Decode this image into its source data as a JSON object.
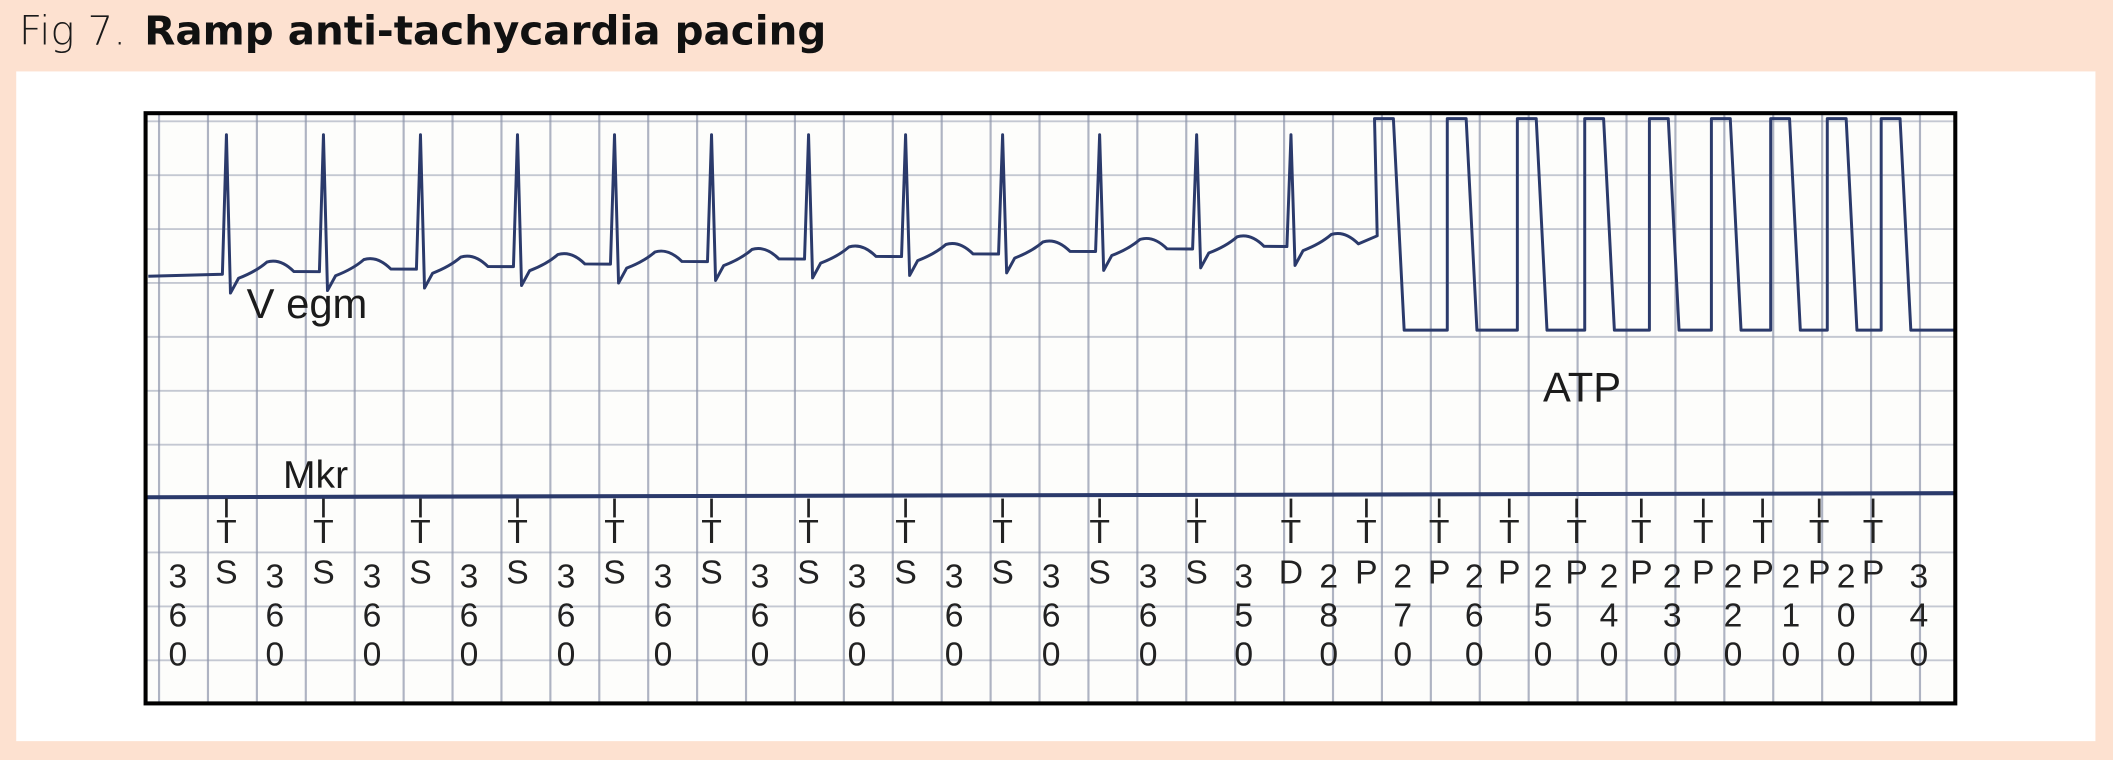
{
  "figure": {
    "label": "Fig 7.",
    "title": "Ramp anti-tachycardia pacing"
  },
  "strip": {
    "channel_top": "V egm",
    "pacing_label": "ATP",
    "channel_bottom": "Mkr"
  },
  "colors": {
    "background": "#fde1d0",
    "trace": "#2b3a6b",
    "grid": "#8d95aa"
  },
  "marker_channel": {
    "intervals": [
      "360",
      "360",
      "360",
      "360",
      "360",
      "360",
      "360",
      "360",
      "360",
      "360",
      "360",
      "350",
      "280",
      "270",
      "260",
      "250",
      "240",
      "230",
      "220",
      "210",
      "200",
      "340"
    ],
    "markers": [
      "TS",
      "TS",
      "TS",
      "TS",
      "TS",
      "TS",
      "TS",
      "TS",
      "TS",
      "TS",
      "TS",
      "TD",
      "TP",
      "TP",
      "TP",
      "TP",
      "TP",
      "TP",
      "TP",
      "TP",
      "TP"
    ]
  }
}
